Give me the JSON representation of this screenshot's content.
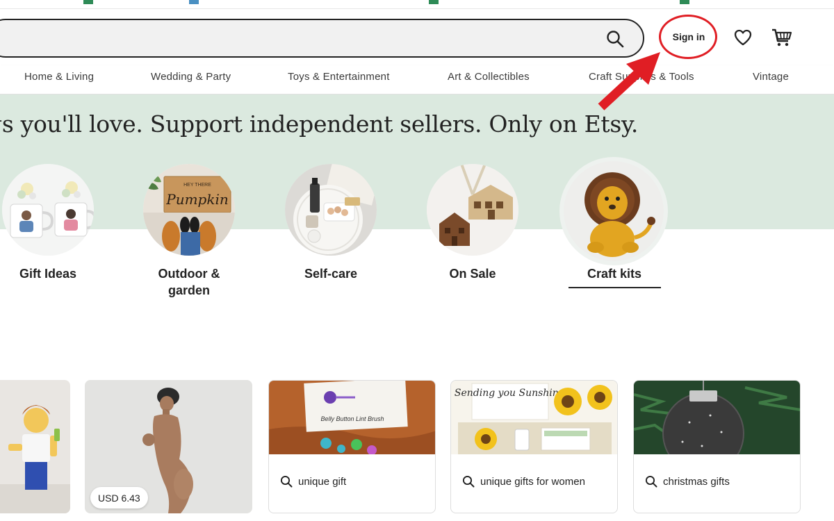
{
  "header": {
    "search": {
      "placeholder": ""
    },
    "sign_in_label": "Sign in"
  },
  "nav": {
    "categories": [
      "Home & Living",
      "Wedding & Party",
      "Toys & Entertainment",
      "Art & Collectibles",
      "Craft Supplies & Tools",
      "Vintage"
    ]
  },
  "hero": {
    "tagline": "gs you'll love. Support independent sellers. Only on Etsy."
  },
  "circles": [
    {
      "label": "Gift Ideas",
      "icon": "mugs-image"
    },
    {
      "label": "Outdoor & garden",
      "icon": "doormat-image"
    },
    {
      "label": "Self-care",
      "icon": "self-care-tray-image"
    },
    {
      "label": "On Sale",
      "icon": "house-ornament-image"
    },
    {
      "label": "Craft kits",
      "icon": "crochet-lion-image",
      "selected": true
    }
  ],
  "listings": [
    {
      "kind": "image",
      "icon": "figure-image"
    },
    {
      "kind": "image",
      "icon": "sculpture-image",
      "price": "USD 6.43"
    },
    {
      "kind": "search",
      "query": "unique gift",
      "image_text": "Belly Button Lint Brush"
    },
    {
      "kind": "search",
      "query": "unique gifts for women",
      "image_text": "Sending you Sunshine"
    },
    {
      "kind": "search",
      "query": "christmas gifts"
    }
  ],
  "colors": {
    "hero_bg": "#dbe9df",
    "annotation_red": "#e01e24",
    "search_bg": "#f1f1f1",
    "text": "#222222"
  }
}
